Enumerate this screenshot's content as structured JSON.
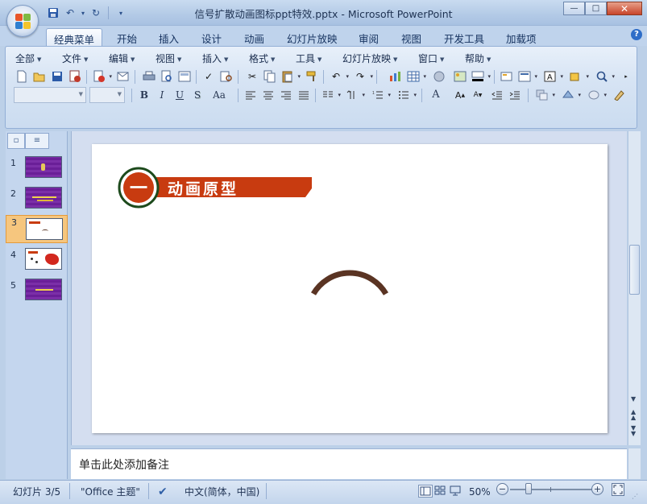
{
  "window": {
    "title": "信号扩散动画图标ppt特效.pptx - Microsoft PowerPoint",
    "minimize": "—",
    "maximize": "□",
    "close": "✕"
  },
  "ribbon_tabs": [
    "经典菜单",
    "开始",
    "插入",
    "设计",
    "动画",
    "幻灯片放映",
    "审阅",
    "视图",
    "开发工具",
    "加载项"
  ],
  "active_tab": "经典菜单",
  "classic_menu": [
    "全部",
    "文件",
    "编辑",
    "视图",
    "插入",
    "格式",
    "工具",
    "幻灯片放映",
    "窗口",
    "帮助"
  ],
  "format_labels": {
    "bold": "B",
    "italic": "I",
    "underline": "U",
    "shadow": "S",
    "change_case": "Aa",
    "font_color": "A"
  },
  "slides": [
    {
      "num": "1",
      "theme": "purple"
    },
    {
      "num": "2",
      "theme": "purple"
    },
    {
      "num": "3",
      "theme": "white"
    },
    {
      "num": "4",
      "theme": "white-map"
    },
    {
      "num": "5",
      "theme": "purple"
    }
  ],
  "selected_slide": 3,
  "slide": {
    "badge_number": "一",
    "heading": "动画原型",
    "colors": {
      "banner": "#c83b10",
      "badge_ring": "#1d4a1c",
      "arc": "#5a3423"
    }
  },
  "notes_placeholder": "单击此处添加备注",
  "status": {
    "slide_counter": "幻灯片 3/5",
    "theme": "\"Office 主题\"",
    "language": "中文(简体，中国)",
    "zoom": "50%",
    "zoom_minus": "−",
    "zoom_plus": "+"
  }
}
